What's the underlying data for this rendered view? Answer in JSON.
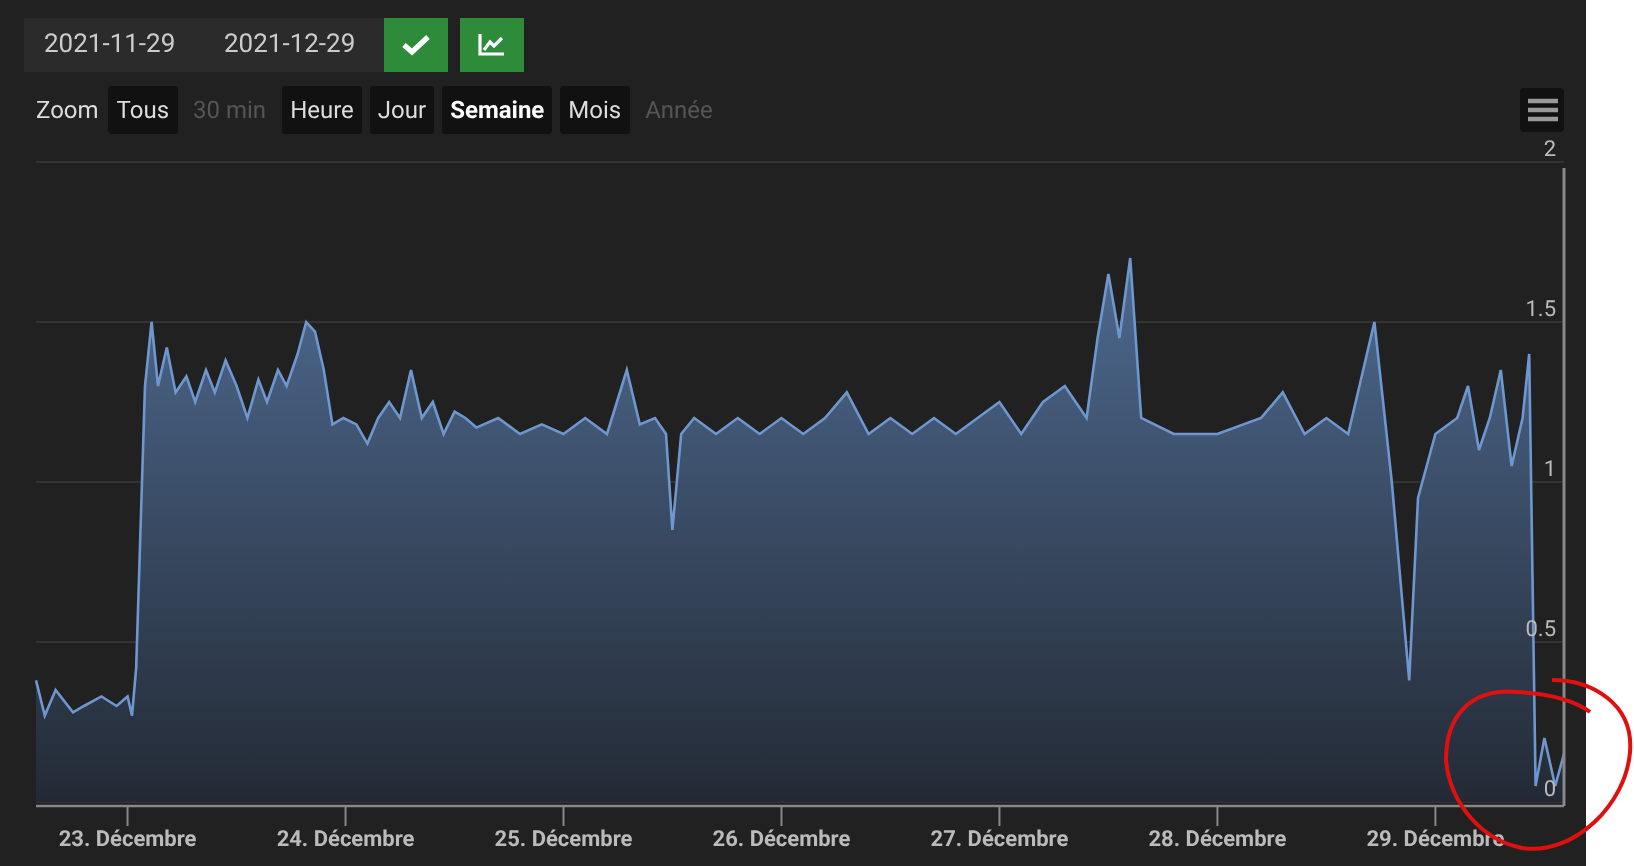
{
  "date_range": {
    "start": "2021-11-29",
    "end": "2021-12-29"
  },
  "zoom": {
    "label": "Zoom",
    "buttons": [
      {
        "label": "Tous",
        "selected": false,
        "disabled": false
      },
      {
        "label": "30 min",
        "selected": false,
        "disabled": true
      },
      {
        "label": "Heure",
        "selected": false,
        "disabled": false
      },
      {
        "label": "Jour",
        "selected": false,
        "disabled": false
      },
      {
        "label": "Semaine",
        "selected": true,
        "disabled": false
      },
      {
        "label": "Mois",
        "selected": false,
        "disabled": false
      },
      {
        "label": "Année",
        "selected": false,
        "disabled": true
      }
    ]
  },
  "chart_data": {
    "type": "area",
    "grid": true,
    "xlim": [
      22.58,
      29.59
    ],
    "ylim": [
      0,
      2
    ],
    "yticks": [
      0,
      0.5,
      1,
      1.5,
      2
    ],
    "xticks": [
      {
        "value": 23,
        "label": "23. Décembre"
      },
      {
        "value": 24,
        "label": "24. Décembre"
      },
      {
        "value": 25,
        "label": "25. Décembre"
      },
      {
        "value": 26,
        "label": "26. Décembre"
      },
      {
        "value": 27,
        "label": "27. Décembre"
      },
      {
        "value": 28,
        "label": "28. Décembre"
      },
      {
        "value": 29,
        "label": "29. Décembre"
      }
    ],
    "x": [
      22.58,
      22.62,
      22.67,
      22.75,
      22.8,
      22.88,
      22.95,
      23,
      23.02,
      23.04,
      23.08,
      23.11,
      23.14,
      23.18,
      23.22,
      23.27,
      23.31,
      23.36,
      23.4,
      23.45,
      23.5,
      23.55,
      23.6,
      23.64,
      23.69,
      23.73,
      23.78,
      23.82,
      23.86,
      23.9,
      23.94,
      23.99,
      24.05,
      24.1,
      24.15,
      24.2,
      24.25,
      24.3,
      24.35,
      24.4,
      24.45,
      24.5,
      24.55,
      24.6,
      24.7,
      24.8,
      24.9,
      25.0,
      25.1,
      25.2,
      25.29,
      25.35,
      25.42,
      25.47,
      25.5,
      25.54,
      25.6,
      25.7,
      25.8,
      25.9,
      26.0,
      26.1,
      26.2,
      26.3,
      26.4,
      26.5,
      26.6,
      26.7,
      26.8,
      26.9,
      27.0,
      27.1,
      27.2,
      27.3,
      27.4,
      27.45,
      27.5,
      27.55,
      27.6,
      27.65,
      27.8,
      28.0,
      28.2,
      28.3,
      28.4,
      28.5,
      28.6,
      28.72,
      28.8,
      28.88,
      28.92,
      29.0,
      29.1,
      29.15,
      29.2,
      29.25,
      29.3,
      29.35,
      29.4,
      29.43,
      29.46,
      29.5,
      29.55,
      29.59
    ],
    "series": [
      {
        "color": "#6f97cf",
        "values": [
          0.38,
          0.27,
          0.35,
          0.28,
          0.3,
          0.33,
          0.3,
          0.33,
          0.27,
          0.42,
          1.3,
          1.5,
          1.3,
          1.42,
          1.28,
          1.33,
          1.25,
          1.35,
          1.28,
          1.38,
          1.3,
          1.2,
          1.32,
          1.25,
          1.35,
          1.3,
          1.4,
          1.5,
          1.47,
          1.35,
          1.18,
          1.2,
          1.18,
          1.12,
          1.2,
          1.25,
          1.2,
          1.35,
          1.2,
          1.25,
          1.15,
          1.22,
          1.2,
          1.17,
          1.2,
          1.15,
          1.18,
          1.15,
          1.2,
          1.15,
          1.35,
          1.18,
          1.2,
          1.15,
          0.85,
          1.15,
          1.2,
          1.15,
          1.2,
          1.15,
          1.2,
          1.15,
          1.2,
          1.28,
          1.15,
          1.2,
          1.15,
          1.2,
          1.15,
          1.2,
          1.25,
          1.15,
          1.25,
          1.3,
          1.2,
          1.45,
          1.65,
          1.45,
          1.7,
          1.2,
          1.15,
          1.15,
          1.2,
          1.28,
          1.15,
          1.2,
          1.15,
          1.5,
          1.0,
          0.38,
          0.95,
          1.15,
          1.2,
          1.3,
          1.1,
          1.2,
          1.35,
          1.05,
          1.2,
          1.4,
          0.05,
          0.2,
          0.05,
          0.15
        ]
      }
    ]
  }
}
